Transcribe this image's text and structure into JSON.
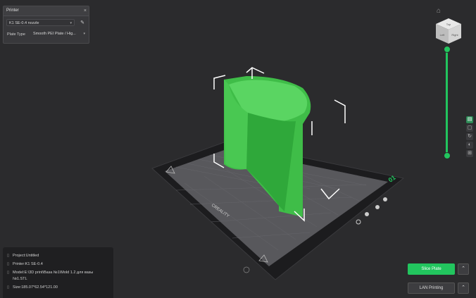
{
  "printer_panel": {
    "title": "Printer",
    "close": "×",
    "nozzle": "K1 SE-0.4 nozzle",
    "plate_type_label": "Plate Type",
    "plate_type": "Smooth PEI Plate / Hig..."
  },
  "plate": {
    "number": "01",
    "brand": "CREALITY"
  },
  "info": {
    "project": "Project:Untitled",
    "printer": "Printer:K1 SE-0.4",
    "model_line1": "Model:E:\\3D print\\Ваза №1\\Mold 1.2 для вазы",
    "model_line2": "№1.STL",
    "size": "Size:185.07*62.54*121.00"
  },
  "buttons": {
    "slice": "Slice Plate",
    "lan": "LAN Printing",
    "chevron": "⌃"
  },
  "view_cube": {
    "top": "Top",
    "left": "Left",
    "right": "Right"
  },
  "icons": {
    "home": "⌂",
    "caret": "▾",
    "edit": "✎"
  },
  "colors": {
    "accent": "#22c55e",
    "model": "#4ccd55"
  }
}
